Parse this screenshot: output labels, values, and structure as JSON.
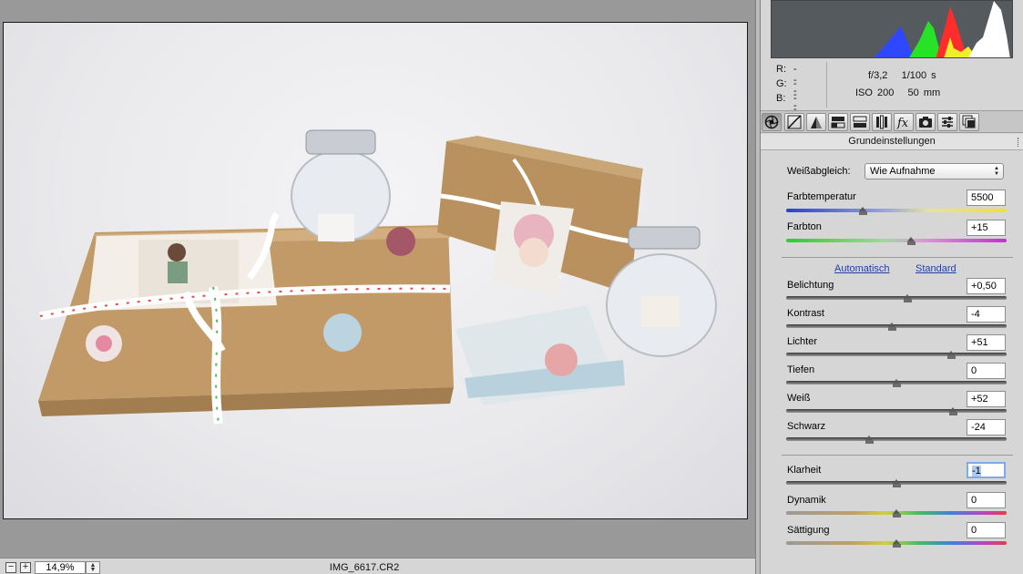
{
  "status": {
    "zoom_value": "14,9%",
    "zoom_minus_icon": "minus-icon",
    "zoom_plus_icon": "plus-icon",
    "filename": "IMG_6617.CR2"
  },
  "info": {
    "r_label": "R:",
    "r_value": "---",
    "g_label": "G:",
    "g_value": "---",
    "b_label": "B:",
    "b_value": "---",
    "aperture": "f/3,2",
    "shutter": "1/100 s",
    "iso": "ISO 200",
    "focal": "50 mm"
  },
  "toolbar": {
    "tools": [
      "aperture-icon",
      "tone-curve-icon",
      "detail-icon",
      "hsl-icon",
      "split-toning-icon",
      "lens-corrections-icon",
      "fx-icon",
      "camera-calibration-icon",
      "presets-icon",
      "snapshots-icon"
    ],
    "fx_label": "fx"
  },
  "panel": {
    "section_title": "Grundeinstellungen",
    "white_balance_label": "Weißabgleich:",
    "white_balance_value": "Wie Aufnahme",
    "auto_link": "Automatisch",
    "standard_link": "Standard"
  },
  "controls": {
    "temperature": {
      "label": "Farbtemperatur",
      "value": "5500",
      "position": 0.35
    },
    "tint": {
      "label": "Farbton",
      "value": "+15",
      "position": 0.57
    },
    "exposure": {
      "label": "Belichtung",
      "value": "+0,50",
      "position": 0.55
    },
    "contrast": {
      "label": "Kontrast",
      "value": "-4",
      "position": 0.48
    },
    "highlights": {
      "label": "Lichter",
      "value": "+51",
      "position": 0.75
    },
    "shadows": {
      "label": "Tiefen",
      "value": "0",
      "position": 0.5
    },
    "whites": {
      "label": "Weiß",
      "value": "+52",
      "position": 0.76
    },
    "blacks": {
      "label": "Schwarz",
      "value": "-24",
      "position": 0.38
    },
    "clarity": {
      "label": "Klarheit",
      "value": "-1",
      "position": 0.5
    },
    "vibrance": {
      "label": "Dynamik",
      "value": "0",
      "position": 0.5
    },
    "saturation": {
      "label": "Sättigung",
      "value": "0",
      "position": 0.5
    }
  }
}
